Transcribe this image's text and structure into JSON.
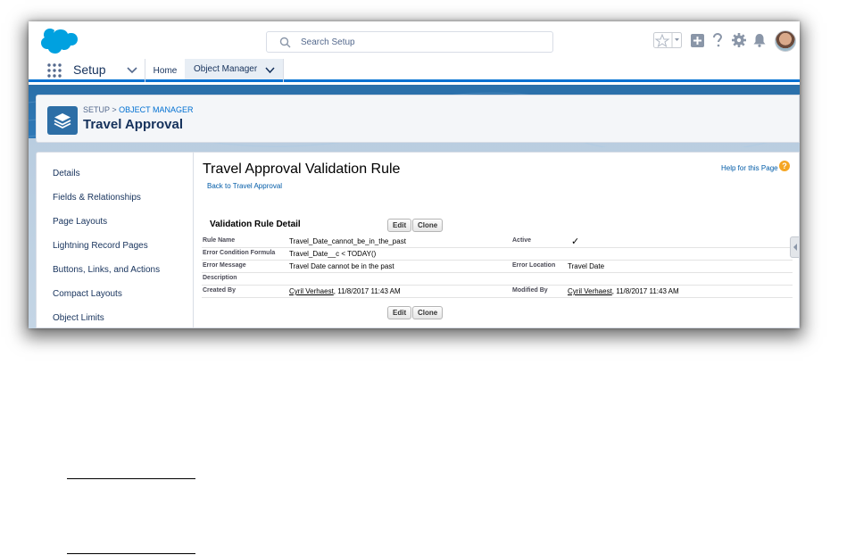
{
  "header": {
    "search_placeholder": "Search Setup",
    "icons": [
      "favorites-icon",
      "add-icon",
      "help-icon",
      "settings-icon",
      "notifications-icon",
      "avatar"
    ]
  },
  "nav": {
    "app_name": "Setup",
    "tabs": [
      {
        "label": "Home"
      },
      {
        "label": "Object Manager",
        "active": true
      }
    ]
  },
  "page_header": {
    "breadcrumb_prefix": "SETUP > ",
    "breadcrumb_link": "OBJECT MANAGER",
    "title": "Travel Approval"
  },
  "sidebar": {
    "items": [
      "Details",
      "Fields & Relationships",
      "Page Layouts",
      "Lightning Record Pages",
      "Buttons, Links, and Actions",
      "Compact Layouts",
      "Object Limits"
    ]
  },
  "main": {
    "title": "Travel Approval Validation Rule",
    "back_link": "Back to Travel Approval",
    "help_link": "Help for this Page",
    "help_icon_glyph": "?",
    "section_title": "Validation Rule Detail",
    "edit_label": "Edit",
    "clone_label": "Clone",
    "fields": {
      "rule_name_label": "Rule Name",
      "rule_name_value": "Travel_Date_cannot_be_in_the_past",
      "active_label": "Active",
      "active_check": "✓",
      "formula_label": "Error Condition Formula",
      "formula_value": "Travel_Date__c < TODAY()",
      "message_label": "Error Message",
      "message_value": "Travel Date cannot be in the past",
      "location_label": "Error Location",
      "location_value": "Travel Date",
      "description_label": "Description",
      "created_label": "Created By",
      "created_user": "Cyril Verhaest",
      "created_date": ", 11/8/2017 11:43 AM",
      "modified_label": "Modified By",
      "modified_user": "Cyril Verhaest",
      "modified_date": ", 11/8/2017 11:43 AM"
    }
  },
  "colors": {
    "brand_blue": "#0070d2",
    "band_blue": "#2f79b7",
    "icon_blue": "#2d6ea6",
    "help_orange": "#f5a623"
  }
}
